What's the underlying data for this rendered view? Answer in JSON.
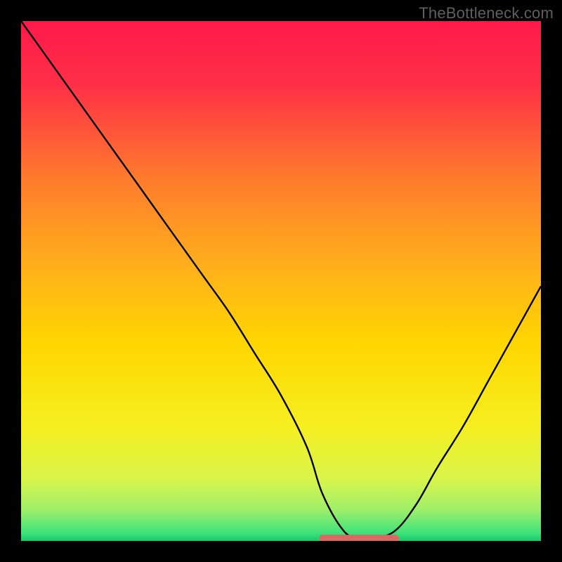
{
  "watermark": "TheBottleneck.com",
  "chart_data": {
    "type": "line",
    "title": "",
    "xlabel": "",
    "ylabel": "",
    "xlim": [
      0,
      100
    ],
    "ylim": [
      0,
      100
    ],
    "grid": false,
    "legend": false,
    "series": [
      {
        "name": "curve",
        "x": [
          0,
          5,
          10,
          15,
          20,
          25,
          30,
          35,
          40,
          45,
          50,
          55,
          58,
          62,
          65,
          68,
          72,
          76,
          80,
          85,
          90,
          95,
          100
        ],
        "values": [
          100,
          93,
          86,
          79,
          72,
          65,
          58,
          51,
          44,
          36,
          28,
          18,
          9,
          2,
          0.5,
          0.5,
          2,
          7,
          14,
          22,
          31,
          40,
          49
        ]
      },
      {
        "name": "marker-segment",
        "x": [
          58,
          72
        ],
        "values": [
          0.5,
          0.5
        ]
      }
    ],
    "background_gradient": {
      "stops": [
        {
          "pos": 0.0,
          "color": "#ff1a4b"
        },
        {
          "pos": 0.12,
          "color": "#ff2e47"
        },
        {
          "pos": 0.3,
          "color": "#ff7a2d"
        },
        {
          "pos": 0.48,
          "color": "#ffb21a"
        },
        {
          "pos": 0.62,
          "color": "#ffd600"
        },
        {
          "pos": 0.78,
          "color": "#f5ef20"
        },
        {
          "pos": 0.88,
          "color": "#d9f54a"
        },
        {
          "pos": 0.94,
          "color": "#9fef6a"
        },
        {
          "pos": 0.985,
          "color": "#3de27a"
        },
        {
          "pos": 1.0,
          "color": "#18c96b"
        }
      ]
    },
    "marker_color": "#d86a63"
  }
}
